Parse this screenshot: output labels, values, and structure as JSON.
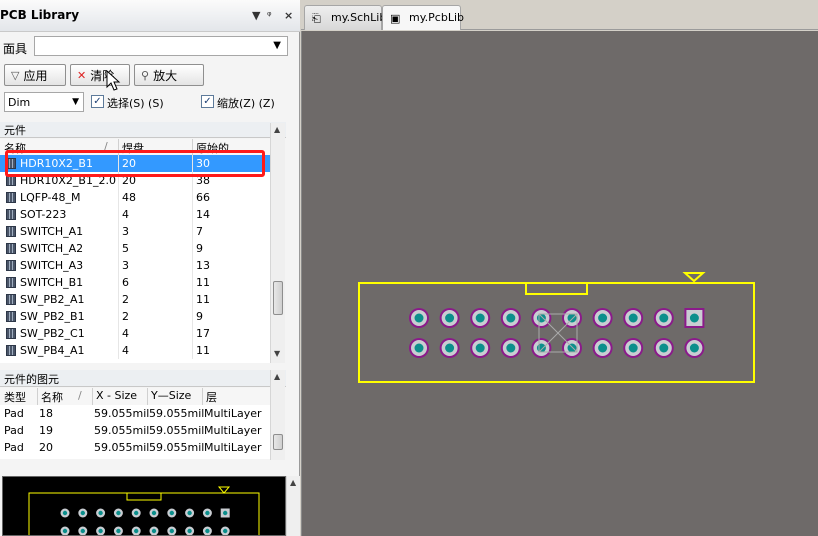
{
  "panel": {
    "title": "PCB Library",
    "ctl_dropdown": "▼",
    "ctl_pin": "ᵠ",
    "ctl_close": "×",
    "mask_label": "面具",
    "mask_value": "",
    "buttons": {
      "apply": "应用",
      "clear": "清除",
      "zoom": "放大"
    },
    "dim_value": "Dim",
    "select_label": "选择(S) (S)",
    "zoom_label": "缩放(Z) (Z)",
    "select_checked": true,
    "zoom_checked": true
  },
  "components": {
    "header": "元件",
    "columns": [
      "名称",
      "焊盘",
      "原始的"
    ],
    "sort_marker": "/",
    "rows": [
      {
        "name": "HDR10X2_B1",
        "pads": "20",
        "primitives": "30",
        "selected": true
      },
      {
        "name": "HDR10X2_B1_2.0",
        "pads": "20",
        "primitives": "38"
      },
      {
        "name": "LQFP-48_M",
        "pads": "48",
        "primitives": "66"
      },
      {
        "name": "SOT-223",
        "pads": "4",
        "primitives": "14"
      },
      {
        "name": "SWITCH_A1",
        "pads": "3",
        "primitives": "7"
      },
      {
        "name": "SWITCH_A2",
        "pads": "5",
        "primitives": "9"
      },
      {
        "name": "SWITCH_A3",
        "pads": "3",
        "primitives": "13"
      },
      {
        "name": "SWITCH_B1",
        "pads": "6",
        "primitives": "11"
      },
      {
        "name": "SW_PB2_A1",
        "pads": "2",
        "primitives": "11"
      },
      {
        "name": "SW_PB2_B1",
        "pads": "2",
        "primitives": "9"
      },
      {
        "name": "SW_PB2_C1",
        "pads": "4",
        "primitives": "17"
      },
      {
        "name": "SW_PB4_A1",
        "pads": "4",
        "primitives": "11"
      }
    ]
  },
  "primitives": {
    "header": "元件的图元",
    "columns": [
      "类型",
      "名称",
      "X - Size",
      "Y—Size",
      "层"
    ],
    "sort_marker": "/",
    "rows": [
      {
        "type": "Pad",
        "name": "18",
        "xsize": "59.055mil",
        "ysize": "59.055mil",
        "layer": "MultiLayer"
      },
      {
        "type": "Pad",
        "name": "19",
        "xsize": "59.055mil",
        "ysize": "59.055mil",
        "layer": "MultiLayer"
      },
      {
        "type": "Pad",
        "name": "20",
        "xsize": "59.055mil",
        "ysize": "59.055mil",
        "layer": "MultiLayer"
      }
    ]
  },
  "tabs": [
    {
      "label": "my.SchLib",
      "active": false
    },
    {
      "label": "my.PcbLib",
      "active": true
    }
  ],
  "colors": {
    "canvas_bg": "#6e6a69",
    "silkscreen": "#ffff00",
    "pad_ring": "#8b1a8b",
    "pad_copper": "#c9cdd2",
    "pad_hole": "#0b8f8c",
    "selection_highlight": "#3399ff",
    "annotation_box": "#ff1a1a"
  },
  "footprint": {
    "rows": 2,
    "cols": 10,
    "pin1_shape": "square"
  }
}
